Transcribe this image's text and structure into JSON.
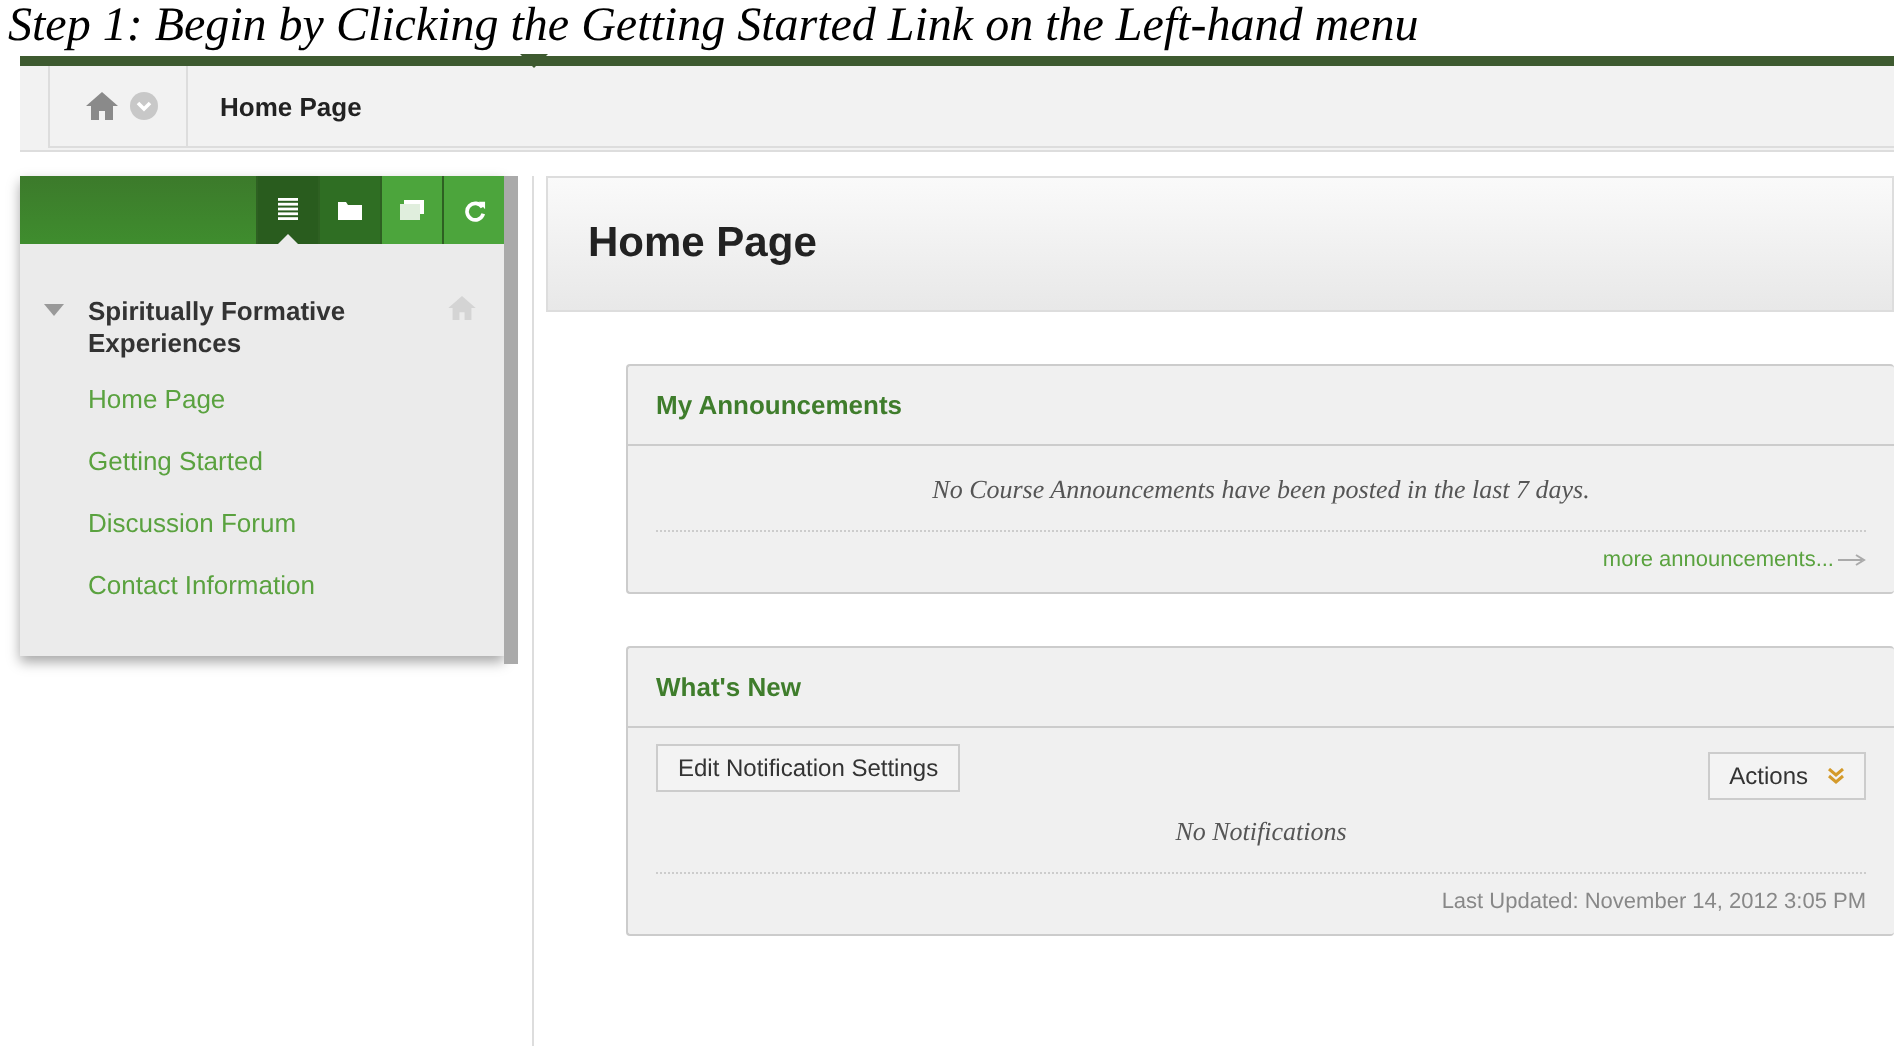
{
  "caption": "Step 1: Begin by Clicking the Getting Started Link on the Left-hand menu",
  "breadcrumb": {
    "label": "Home Page"
  },
  "menu_tools": [
    {
      "kind": "list",
      "selected": true
    },
    {
      "kind": "folder",
      "selected": false
    },
    {
      "kind": "window",
      "selected": false
    },
    {
      "kind": "refresh",
      "selected": false
    }
  ],
  "course": {
    "title": "Spiritually Formative Experiences",
    "expanded": true,
    "items": [
      "Home Page",
      "Getting Started",
      "Discussion Forum",
      "Contact Information"
    ]
  },
  "page_title": "Home Page",
  "announcements": {
    "title": "My Announcements",
    "message": "No Course Announcements have been posted in the last 7 days.",
    "link": "more announcements..."
  },
  "whats_new": {
    "title": "What's New",
    "button": "Edit Notification Settings",
    "actions": "Actions",
    "message": "No Notifications",
    "updated": "Last Updated: November 14, 2012 3:05 PM"
  }
}
